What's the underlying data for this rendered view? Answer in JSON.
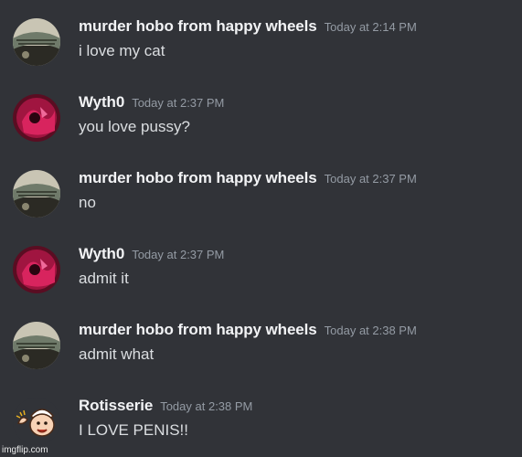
{
  "messages": [
    {
      "username": "murder hobo from happy wheels",
      "timestamp": "Today at 2:14 PM",
      "content": "i love my cat",
      "avatar": "hobo-avatar"
    },
    {
      "username": "Wyth0",
      "timestamp": "Today at 2:37 PM",
      "content": "you love pussy?",
      "avatar": "wyth0-avatar"
    },
    {
      "username": "murder hobo from happy wheels",
      "timestamp": "Today at 2:37 PM",
      "content": "no",
      "avatar": "hobo-avatar"
    },
    {
      "username": "Wyth0",
      "timestamp": "Today at 2:37 PM",
      "content": "admit it",
      "avatar": "wyth0-avatar"
    },
    {
      "username": "murder hobo from happy wheels",
      "timestamp": "Today at 2:38 PM",
      "content": "admit what",
      "avatar": "hobo-avatar"
    },
    {
      "username": "Rotisserie",
      "timestamp": "Today at 2:38 PM",
      "content": "I LOVE PENIS!!",
      "avatar": "rotisserie-avatar"
    }
  ],
  "watermark": "imgflip.com",
  "colors": {
    "background": "#313338",
    "username": "#f2f3f5",
    "timestamp": "#949ba4",
    "content": "#dbdee1"
  }
}
